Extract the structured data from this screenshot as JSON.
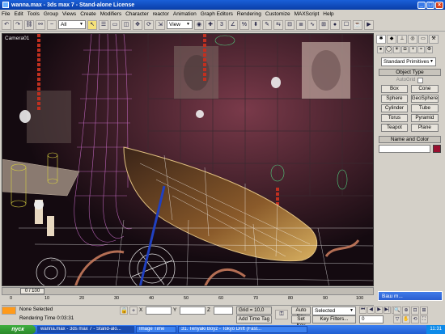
{
  "window": {
    "title": "wanna.max - 3ds max 7 - Stand-alone License"
  },
  "menu": [
    "File",
    "Edit",
    "Tools",
    "Group",
    "Views",
    "Create",
    "Modifiers",
    "Character",
    "reactor",
    "Animation",
    "Graph Editors",
    "Rendering",
    "Customize",
    "MAXScript",
    "Help"
  ],
  "toolbar": {
    "selection_filter": "All",
    "ref_coord": "View"
  },
  "viewport": {
    "label": "Camera01"
  },
  "command_panel": {
    "category": "Standard Primitives",
    "object_type_title": "Object Type",
    "autogrid_label": "AutoGrid",
    "primitives": [
      "Box",
      "Cone",
      "Sphere",
      "GeoSphere",
      "Cylinder",
      "Tube",
      "Torus",
      "Pyramid",
      "Teapot",
      "Plane"
    ],
    "name_color_title": "Name and Color",
    "object_color": "#9a1030"
  },
  "time": {
    "frame_display": "0 / 100",
    "ticks": [
      "0",
      "10",
      "20",
      "30",
      "40",
      "50",
      "60",
      "70",
      "80",
      "90",
      "100"
    ]
  },
  "status": {
    "selection": "None Selected",
    "rendering_time": "Rendering Time  0:03:31",
    "x_label": "X",
    "y_label": "Y",
    "z_label": "Z",
    "grid": "Grid = 10,0",
    "add_time_tag": "Add Time Tag",
    "auto_key": "Auto Key",
    "set_key": "Set Key",
    "key_mode": "Selected",
    "key_filters": "Key Filters...",
    "current_frame": "0"
  },
  "help_box": {
    "label": "Ваш m..."
  },
  "taskbar": {
    "start": "пуск",
    "tasks": [
      "wanna.max - 3ds max 7 - Stand-alo...",
      "Image Time",
      "31. Teriyaki Boyz - Tokyo Drift (Fast..."
    ],
    "clock": "11:31"
  },
  "colors": {
    "accent": "#1a5fd8",
    "viewport_bg": "#1a1216"
  }
}
